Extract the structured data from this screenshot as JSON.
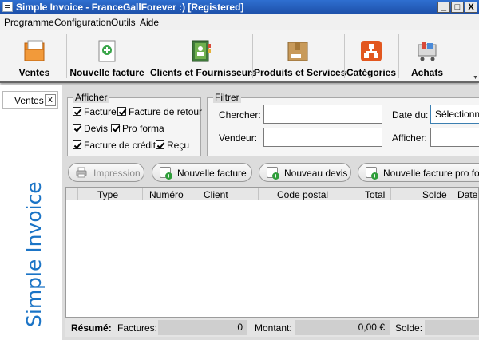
{
  "window": {
    "title": "Simple Invoice - FranceGallForever :)  [Registered]",
    "min_glyph": "_",
    "max_glyph": "□",
    "close_glyph": "X"
  },
  "menu": [
    "Programme",
    "Configuration",
    "Outils",
    "Aide"
  ],
  "ribbon": {
    "buttons": [
      {
        "label": "Ventes",
        "icon": "sales-folder-icon"
      },
      {
        "label": "Nouvelle facture",
        "icon": "new-invoice-icon"
      },
      {
        "label": "Clients et Fournisseurs",
        "icon": "address-book-icon"
      },
      {
        "label": "Produits et Services",
        "icon": "product-box-icon"
      },
      {
        "label": "Catégories",
        "icon": "categories-icon"
      },
      {
        "label": "Achats",
        "icon": "shopping-cart-icon"
      }
    ],
    "scroll_glyph": "▼"
  },
  "sidebar": {
    "tab_label": "Ventes",
    "tab_close": "x",
    "brand": "Simple Invoice"
  },
  "afficher": {
    "title": "Afficher",
    "checkboxes": [
      {
        "label": "Facture",
        "checked": true
      },
      {
        "label": "Facture de retour",
        "checked": true
      },
      {
        "label": "Devis",
        "checked": true
      },
      {
        "label": "Pro forma",
        "checked": true
      },
      {
        "label": "Facture de crédit",
        "checked": true
      },
      {
        "label": "Reçu",
        "checked": true
      }
    ]
  },
  "filtrer": {
    "title": "Filtrer",
    "chercher_label": "Chercher:",
    "chercher_value": "",
    "vendeur_label": "Vendeur:",
    "vendeur_value": "",
    "date_label": "Date du:",
    "date_value": "Sélectionne",
    "afficher_label": "Afficher:",
    "afficher_value": ""
  },
  "actions": {
    "impression": "Impression",
    "nouvelle_facture": "Nouvelle facture",
    "nouveau_devis": "Nouveau devis",
    "nouvelle_pro_forma": "Nouvelle facture pro fo"
  },
  "table": {
    "columns": [
      "Type",
      "Numéro",
      "Client",
      "Code postal",
      "Total",
      "Solde",
      "Date"
    ],
    "rows": []
  },
  "summary": {
    "resume_label": "Résumé:",
    "factures_label": "Factures:",
    "factures_value": "0",
    "montant_label": "Montant:",
    "montant_value": "0,00 €",
    "solde_label": "Solde:",
    "solde_value": ""
  }
}
